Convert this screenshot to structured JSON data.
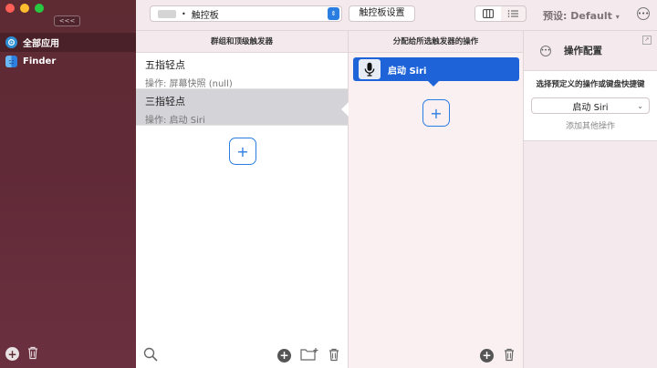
{
  "sidebar": {
    "collapse_label": "<<<",
    "items": [
      {
        "label": "全部应用",
        "icon": "all-apps-icon"
      },
      {
        "label": "Finder",
        "icon": "finder-icon"
      }
    ]
  },
  "toolbar": {
    "device": "触控板",
    "settings_label": "触控板设置",
    "preset_label": "预设: Default"
  },
  "triggers": {
    "header": "群组和顶级触发器",
    "items": [
      {
        "name": "五指轻点",
        "action": "操作: 屏幕快照 (null)"
      },
      {
        "name": "三指轻点",
        "action": "操作: 启动 Siri"
      }
    ],
    "add_label": "+"
  },
  "actions": {
    "header": "分配给所选触发器的操作",
    "items": [
      {
        "label": "启动 Siri"
      }
    ],
    "add_label": "+"
  },
  "config": {
    "title": "操作配置",
    "prompt": "选择预定义的操作或键盘快捷键",
    "selected": "启动 Siri",
    "add_other": "添加其他操作"
  },
  "colors": {
    "accent": "#2a7de1",
    "action_card": "#1e64d8",
    "sidebar": "#5e2b33"
  }
}
